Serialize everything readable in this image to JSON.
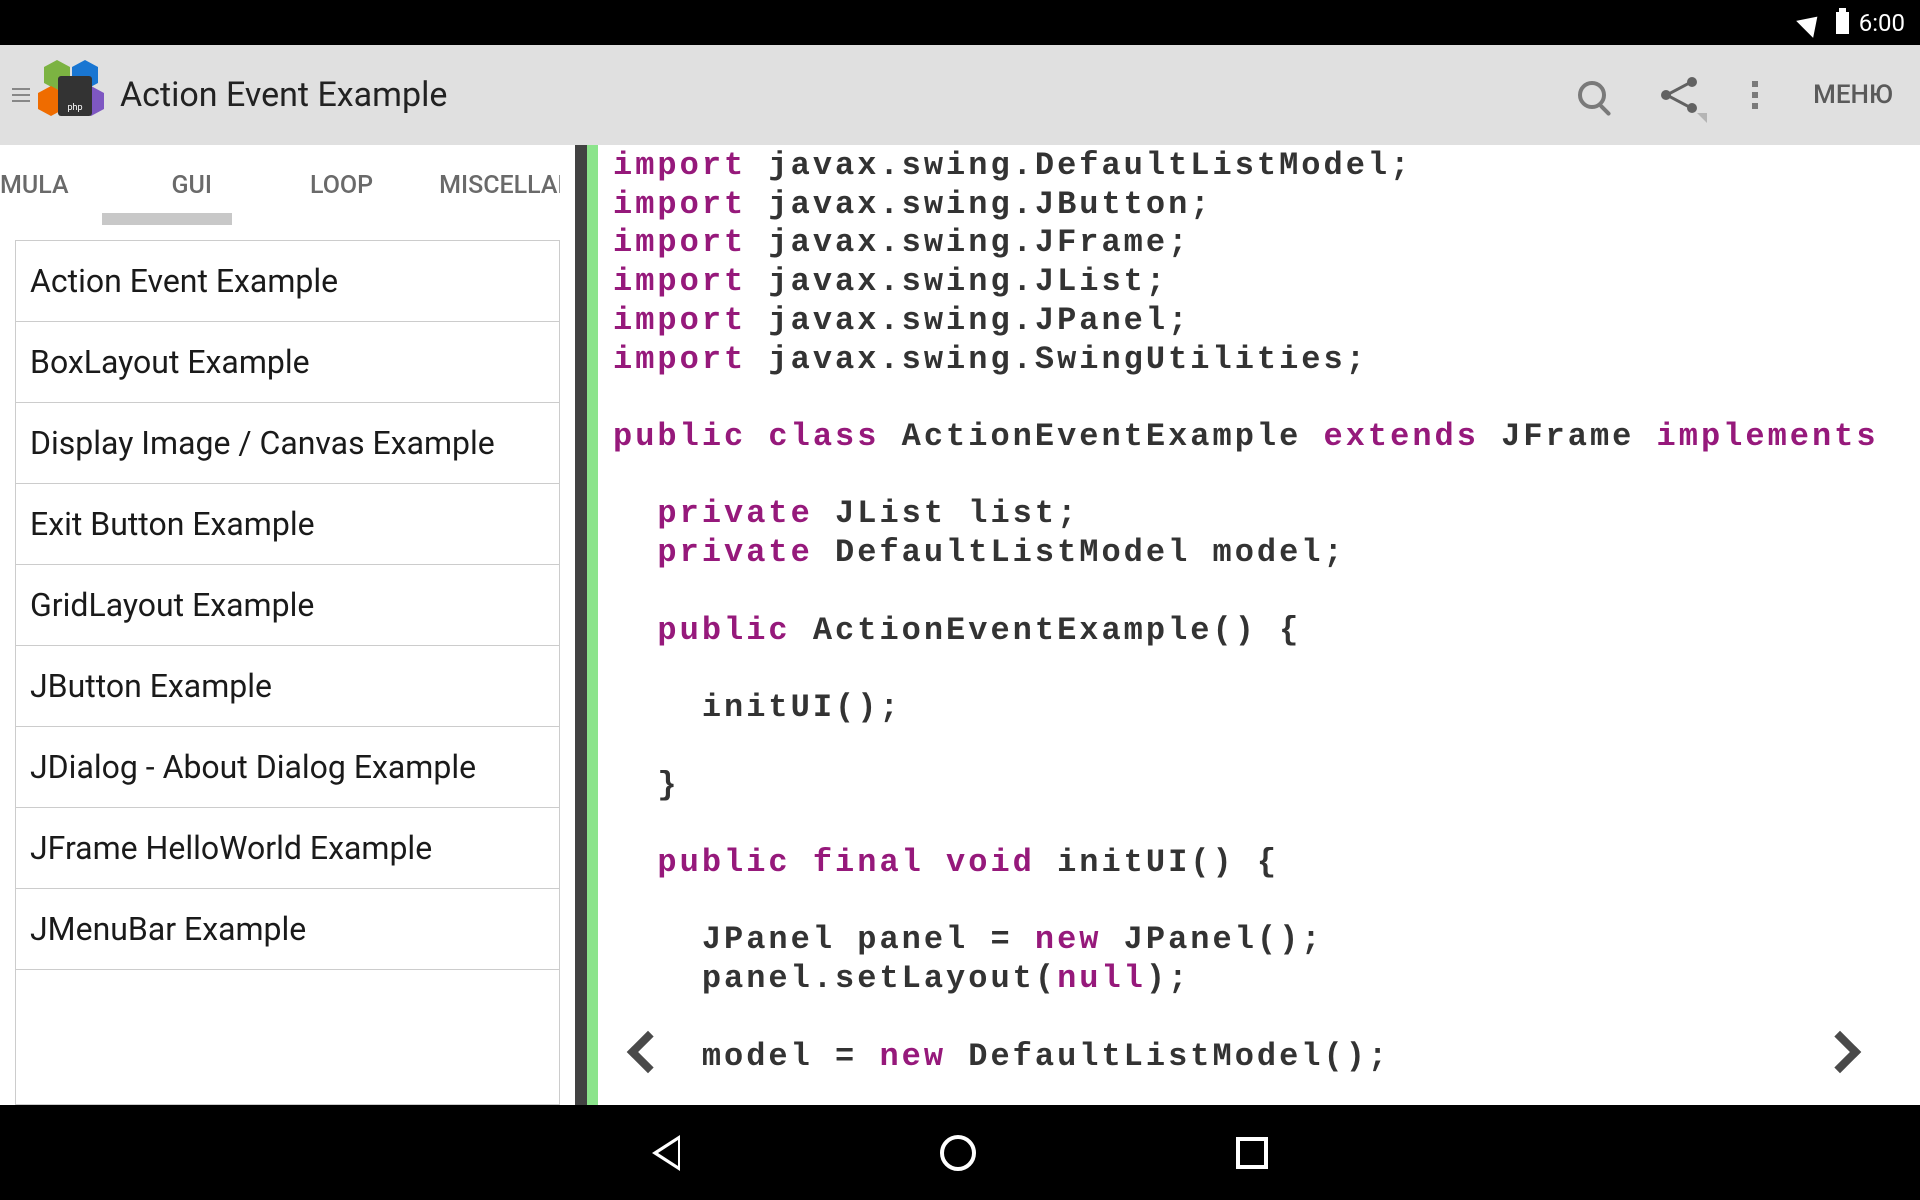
{
  "status": {
    "time": "6:00"
  },
  "toolbar": {
    "title": "Action Event Example",
    "menu_label": "МЕНЮ"
  },
  "tabs": [
    "MULA",
    "GUI",
    "LOOP",
    "MISCELLAN"
  ],
  "sidebar_items": [
    "Action Event Example",
    "BoxLayout Example",
    "Display Image / Canvas Example",
    "Exit Button Example",
    "GridLayout Example",
    "JButton Example",
    "JDialog - About Dialog Example",
    "JFrame HelloWorld Example",
    "JMenuBar Example"
  ],
  "code": {
    "kw_import": "import",
    "imp0": "javax.swing.DefaultListModel;",
    "imp1": "javax.swing.JButton;",
    "imp2": "javax.swing.JFrame;",
    "imp3": "javax.swing.JList;",
    "imp4": "javax.swing.JPanel;",
    "imp5": "javax.swing.SwingUtilities;",
    "kw_public": "public",
    "kw_class": "class",
    "class_name": "ActionEventExample",
    "kw_extends": "extends",
    "extends_name": "JFrame",
    "kw_implements": "implements",
    "kw_private": "private",
    "field1_type": "JList list;",
    "field2_type": "DefaultListModel model;",
    "ctor_sig": "ActionEventExample() {",
    "ctor_body": "initUI();",
    "close_brace": "}",
    "kw_final": "final",
    "kw_void": "void",
    "initui_sig": "initUI() {",
    "panel_decl1": "JPanel panel = ",
    "kw_new": "new",
    "panel_decl2": " JPanel();",
    "panel_layout1": "panel.setLayout(",
    "kw_null": "null",
    "panel_layout2": ");",
    "model_decl1": "model = ",
    "model_decl2": " DefaultListModel();"
  }
}
